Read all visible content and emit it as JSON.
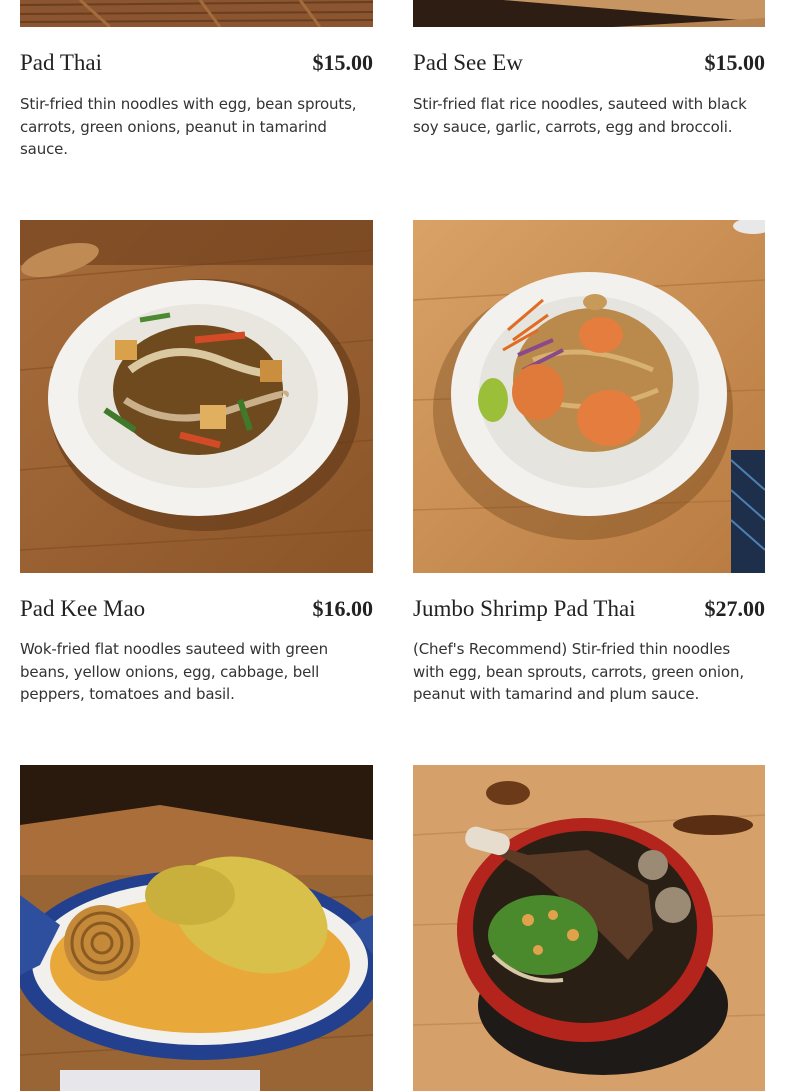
{
  "menu": {
    "items": [
      {
        "name": "Pad Thai",
        "price": "$15.00",
        "description": "Stir-fried thin noodles with egg, bean sprouts, carrots, green onions, peanut in tamarind sauce.",
        "photo": "pad-thai-photo"
      },
      {
        "name": "Pad See Ew",
        "price": "$15.00",
        "description": "Stir-fried flat rice noodles, sauteed with black soy sauce, garlic, carrots, egg and broccoli.",
        "photo": "pad-see-ew-photo"
      },
      {
        "name": "Pad Kee Mao",
        "price": "$16.00",
        "description": "Wok-fried flat noodles sauteed with green beans, yellow onions, egg, cabbage, bell peppers, tomatoes and basil.",
        "photo": "pad-kee-mao-photo"
      },
      {
        "name": "Jumbo Shrimp Pad Thai",
        "price": "$27.00",
        "description": "(Chef's Recommend) Stir-fried thin noodles with egg, bean sprouts, carrots, green onion, peanut with tamarind and plum sauce.",
        "photo": "jumbo-shrimp-pad-thai-photo"
      },
      {
        "name": "",
        "price": "",
        "description": "",
        "photo": "khao-soi-chicken-photo"
      },
      {
        "name": "",
        "price": "",
        "description": "",
        "photo": "beef-short-rib-noodle-soup-photo"
      }
    ]
  },
  "colors": {
    "wood": "#b87a45",
    "wood_dark": "#7a4a25",
    "plate": "#f3f1ec",
    "text": "#222222"
  }
}
